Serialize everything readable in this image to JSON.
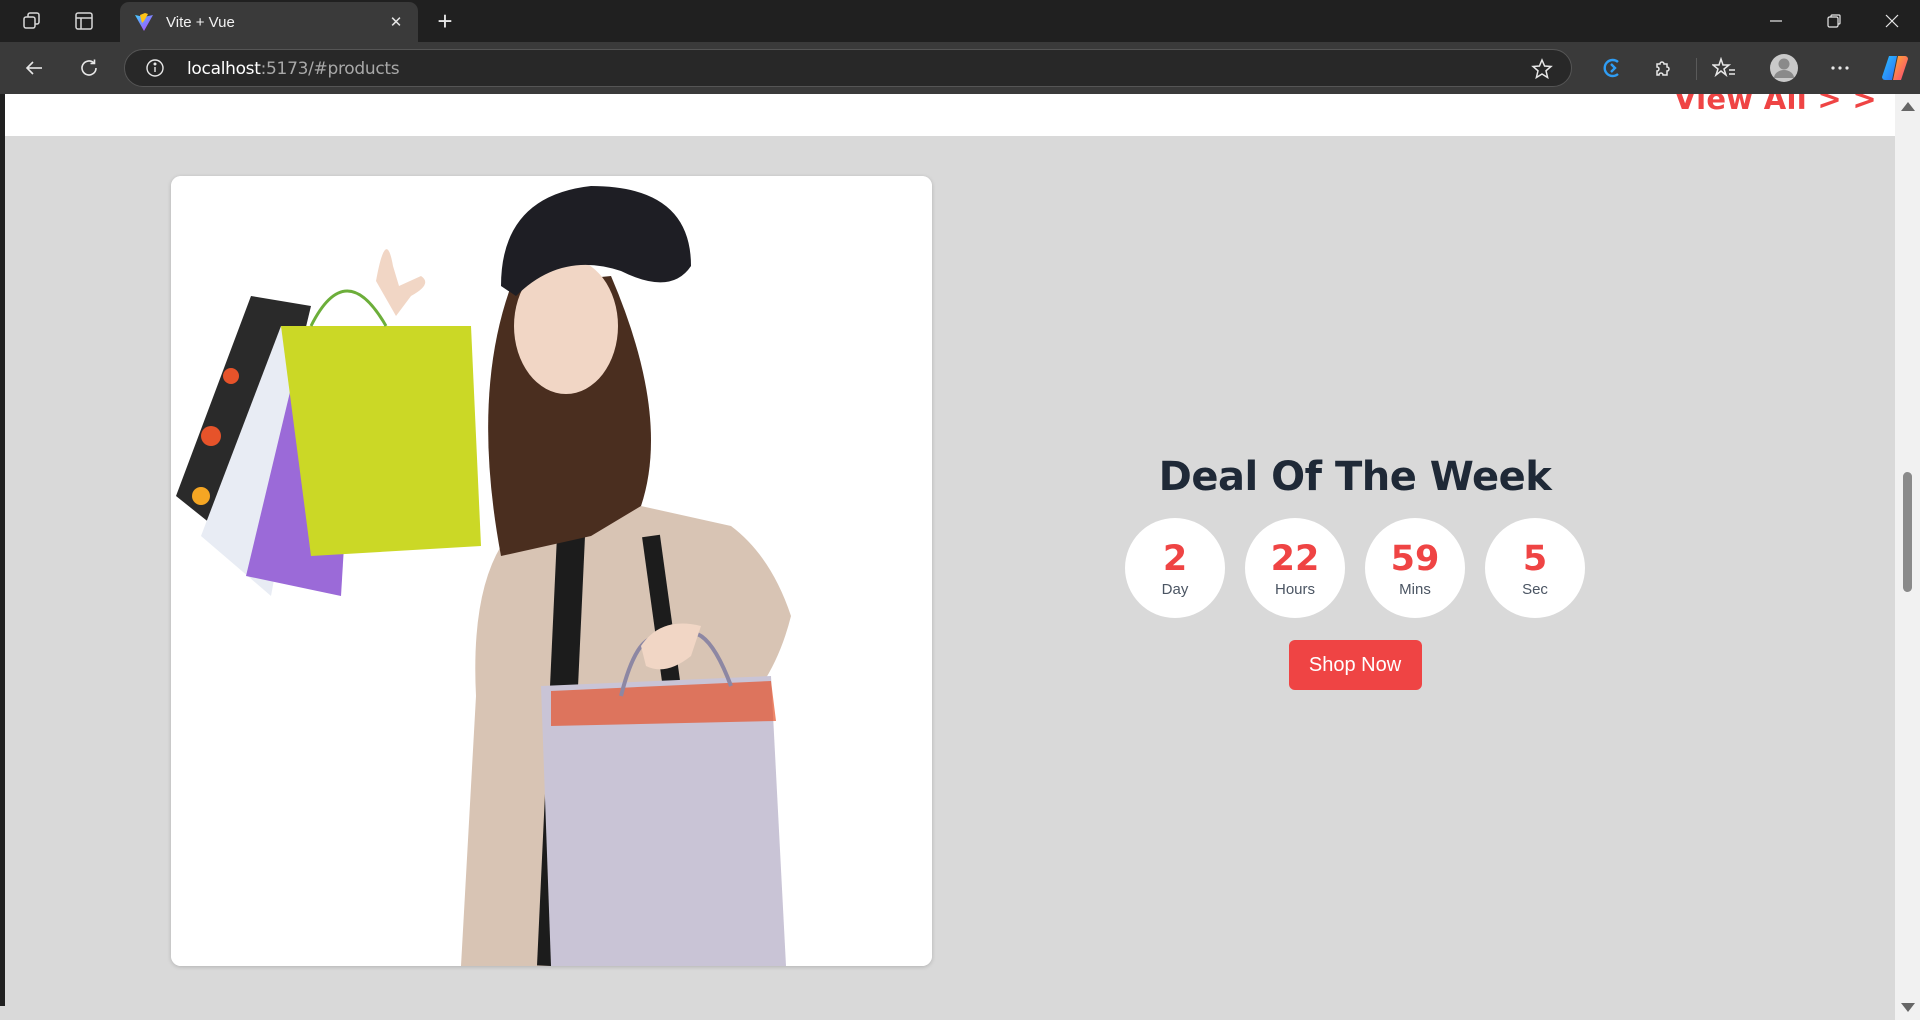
{
  "browser": {
    "tab_title": "Vite + Vue",
    "url_host": "localhost",
    "url_path": ":5173/#products",
    "icons": {
      "workspaces": "workspaces-icon",
      "tab_actions": "tab-actions-icon",
      "favicon": "vite-logo-icon",
      "close_tab": "close-icon",
      "new_tab": "plus-icon",
      "back": "back-arrow-icon",
      "refresh": "refresh-icon",
      "site_info": "info-icon",
      "favorite": "star-icon",
      "extension_1": "edge-extension-icon",
      "extensions": "puzzle-icon",
      "favorites": "favorites-icon",
      "profile": "profile-avatar-icon",
      "more": "more-icon",
      "copilot": "copilot-icon",
      "minimize": "minimize-icon",
      "maximize": "restore-icon",
      "close_window": "close-window-icon"
    }
  },
  "page": {
    "view_all_link": "View All > >",
    "deal": {
      "title": "Deal Of The Week",
      "countdown": [
        {
          "value": "2",
          "label": "Day"
        },
        {
          "value": "22",
          "label": "Hours"
        },
        {
          "value": "59",
          "label": "Mins"
        },
        {
          "value": "5",
          "label": "Sec"
        }
      ],
      "button_label": "Shop Now"
    },
    "colors": {
      "accent": "#ef4444",
      "heading": "#1f2937",
      "section_bg": "#d9d9d9"
    }
  }
}
